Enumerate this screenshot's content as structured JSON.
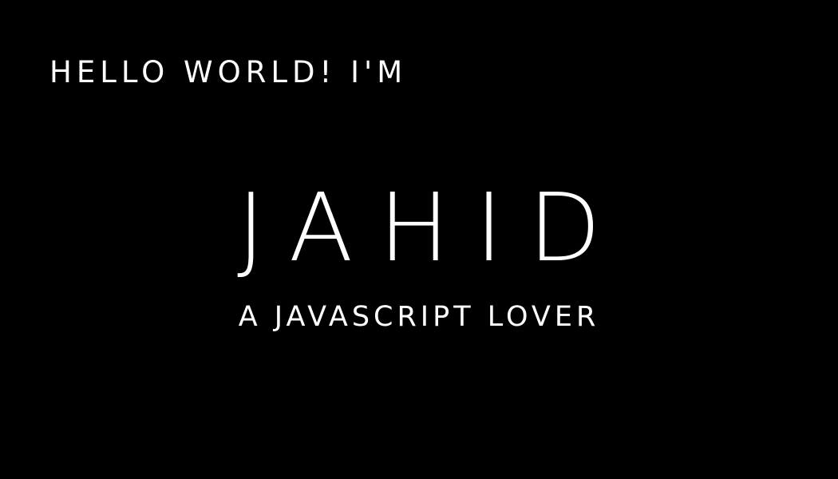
{
  "theme": {
    "background": "#000000",
    "text_color": "#ffffff"
  },
  "intro": {
    "greeting": "HELLO WORLD! I'M",
    "name": "JAHID",
    "tagline": "A JAVASCRIPT LOVER"
  }
}
